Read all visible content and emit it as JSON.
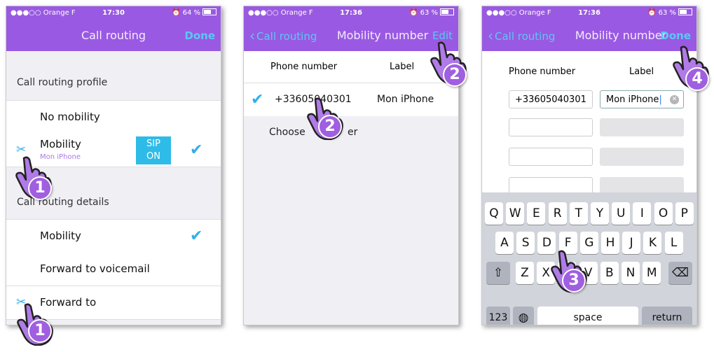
{
  "status": {
    "carrier": "●●●○○ Orange F",
    "p1_time": "17:30",
    "p1_battery": "64 %",
    "p2_time": "17:36",
    "p2_battery": "63 %",
    "p3_time": "17:36",
    "p3_battery": "63 %"
  },
  "panel1": {
    "title": "Call routing",
    "done": "Done",
    "profile_header": "Call routing profile",
    "no_mobility": "No mobility",
    "mobility": "Mobility",
    "mobility_sub": "Mon iPhone",
    "sip_label_1": "SIP",
    "sip_label_2": "ON",
    "details_header": "Call routing details",
    "detail_mobility": "Mobility",
    "forward_voicemail": "Forward to voicemail",
    "forward_to": "Forward to"
  },
  "panel2": {
    "back": "Call routing",
    "title": "Mobility number",
    "edit": "Edit",
    "col_phone": "Phone number",
    "col_label": "Label",
    "phone": "+33605040301",
    "label": "Mon iPhone",
    "choose": "Choose",
    "choose_tail": "er"
  },
  "panel3": {
    "back": "Call routing",
    "title": "Mobility number",
    "done": "Done",
    "col_phone": "Phone number",
    "col_label": "Label",
    "phone": "+33605040301",
    "label": "Mon iPhone"
  },
  "keyboard": {
    "row1": [
      "Q",
      "W",
      "E",
      "R",
      "T",
      "Y",
      "U",
      "I",
      "O",
      "P"
    ],
    "row2": [
      "A",
      "S",
      "D",
      "F",
      "G",
      "H",
      "J",
      "K",
      "L"
    ],
    "row3": [
      "Z",
      "X",
      "C",
      "V",
      "B",
      "N",
      "M"
    ],
    "num": "123",
    "space": "space",
    "return": "return"
  },
  "steps": {
    "one": "1",
    "two": "2",
    "three": "3",
    "four": "4"
  },
  "colors": {
    "accent": "#9a59e2",
    "link": "#59c8f5",
    "check": "#2fb0ea",
    "sip": "#2fbbe8"
  },
  "icons": [
    "tools-icon",
    "checkmark-icon",
    "back-chevron-icon",
    "clear-icon",
    "shift-icon",
    "delete-icon",
    "globe-icon",
    "hand-pointer-icon"
  ]
}
